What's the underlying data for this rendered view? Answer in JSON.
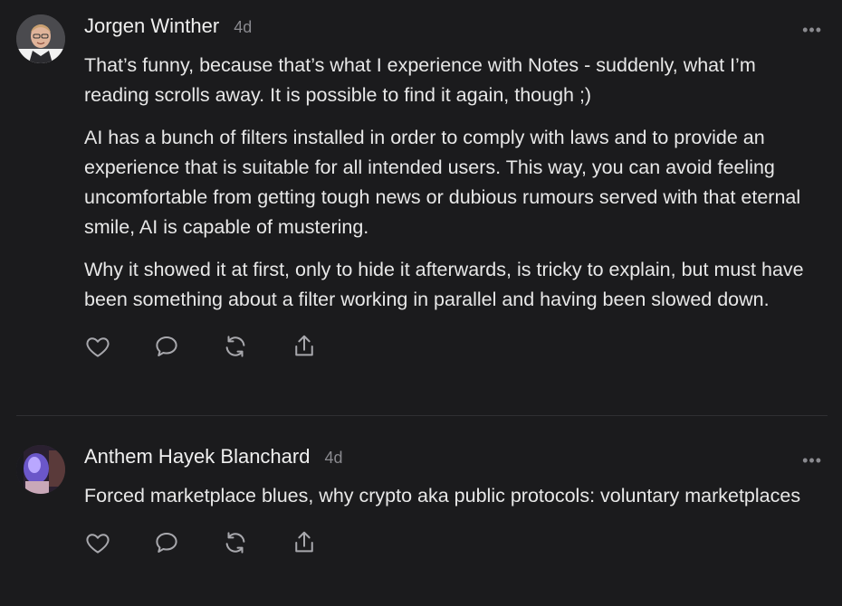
{
  "comments": [
    {
      "author": "Jorgen Winther",
      "age": "4d",
      "paragraphs": [
        "That’s funny, because that’s what I experience with Notes - suddenly, what I’m reading scrolls away. It is possible to find it again, though ;)",
        "AI has a bunch of filters installed in order to comply with laws and to provide an experience that is suitable for all intended users. This way, you can avoid feeling uncomfortable from getting tough news or dubious rumours served with that eternal smile, AI is capable of mustering.",
        "Why it showed it at first, only to hide it afterwards, is tricky to explain, but must have been something about a filter working in parallel and having been slowed down."
      ],
      "more": "•••"
    },
    {
      "author": "Anthem Hayek Blanchard",
      "age": "4d",
      "paragraphs": [
        "Forced marketplace blues, why crypto aka public protocols: voluntary marketplaces"
      ],
      "more": "•••"
    }
  ],
  "icons": {
    "like": "heart-icon",
    "reply": "comment-icon",
    "restack": "restack-icon",
    "share": "share-icon"
  },
  "colors": {
    "background": "#1b1b1d",
    "text": "#e8e8e8",
    "muted": "#8a8a8f",
    "divider": "#2f2f33"
  }
}
